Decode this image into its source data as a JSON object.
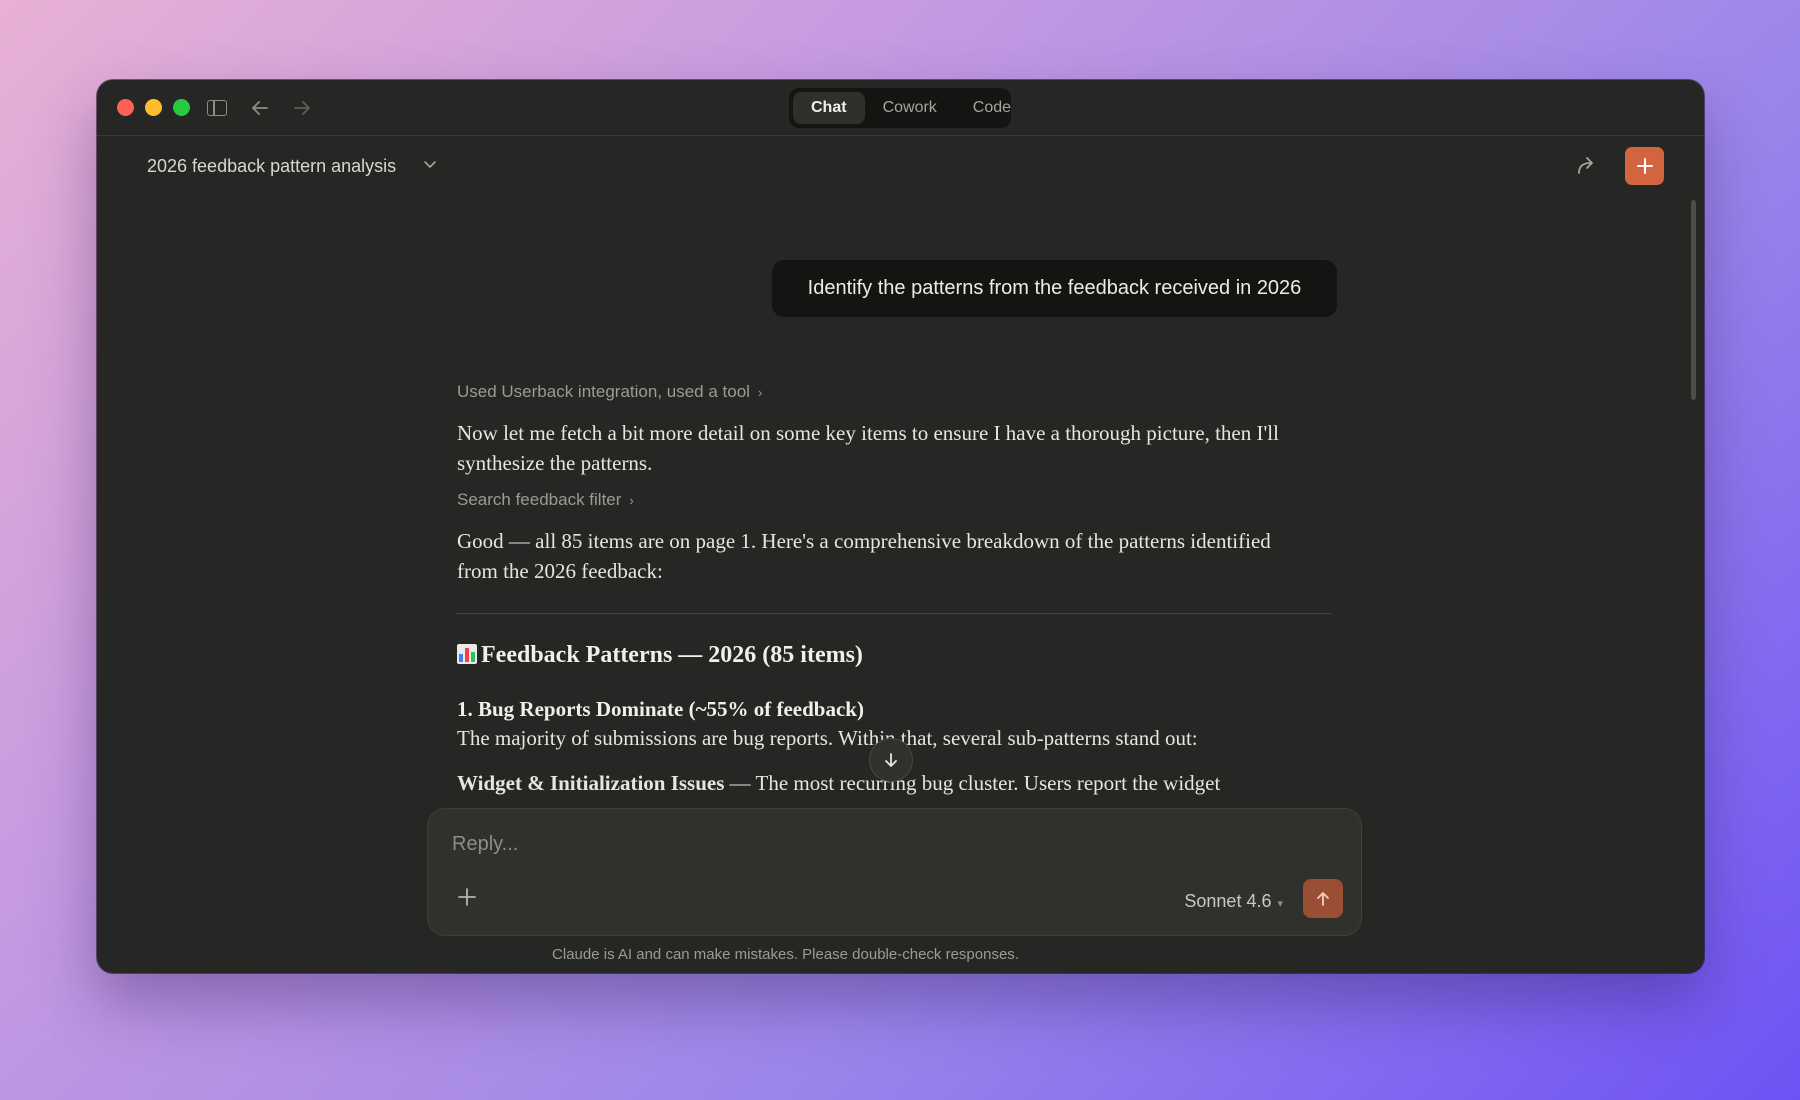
{
  "window": {
    "tabs": [
      {
        "label": "Chat",
        "active": true
      },
      {
        "label": "Cowork",
        "active": false
      },
      {
        "label": "Code",
        "active": false
      }
    ]
  },
  "header": {
    "title": "2026 feedback pattern analysis"
  },
  "conversation": {
    "user_message": "Identify the patterns from the feedback received in 2026",
    "tool_use_1": "Used Userback integration, used a tool",
    "para_1": "Now let me fetch a bit more detail on some key items to ensure I have a thorough picture, then I'll synthesize the patterns.",
    "tool_use_2": "Search feedback filter",
    "para_2": "Good — all 85 items are on page 1. Here's a comprehensive breakdown of the patterns identified from the 2026 feedback:",
    "heading": "Feedback Patterns — 2026 (85 items)",
    "subheading": "1. Bug Reports Dominate (~55% of feedback)",
    "para_3": "The majority of submissions are bug reports. Within that, several sub-patterns stand out:",
    "para_4_bold": "Widget & Initialization Issues",
    "para_4_rest": " — The most recurring bug cluster. Users report the widget"
  },
  "composer": {
    "placeholder": "Reply...",
    "model": "Sonnet 4.6"
  },
  "footer": {
    "disclaimer": "Claude is AI and can make mistakes. Please double-check responses."
  },
  "icons": {
    "chart_emoji": "bar-chart-icon",
    "bug_emoji": "bug-icon"
  },
  "colors": {
    "accent": "#d2643f",
    "background": "#262624"
  }
}
